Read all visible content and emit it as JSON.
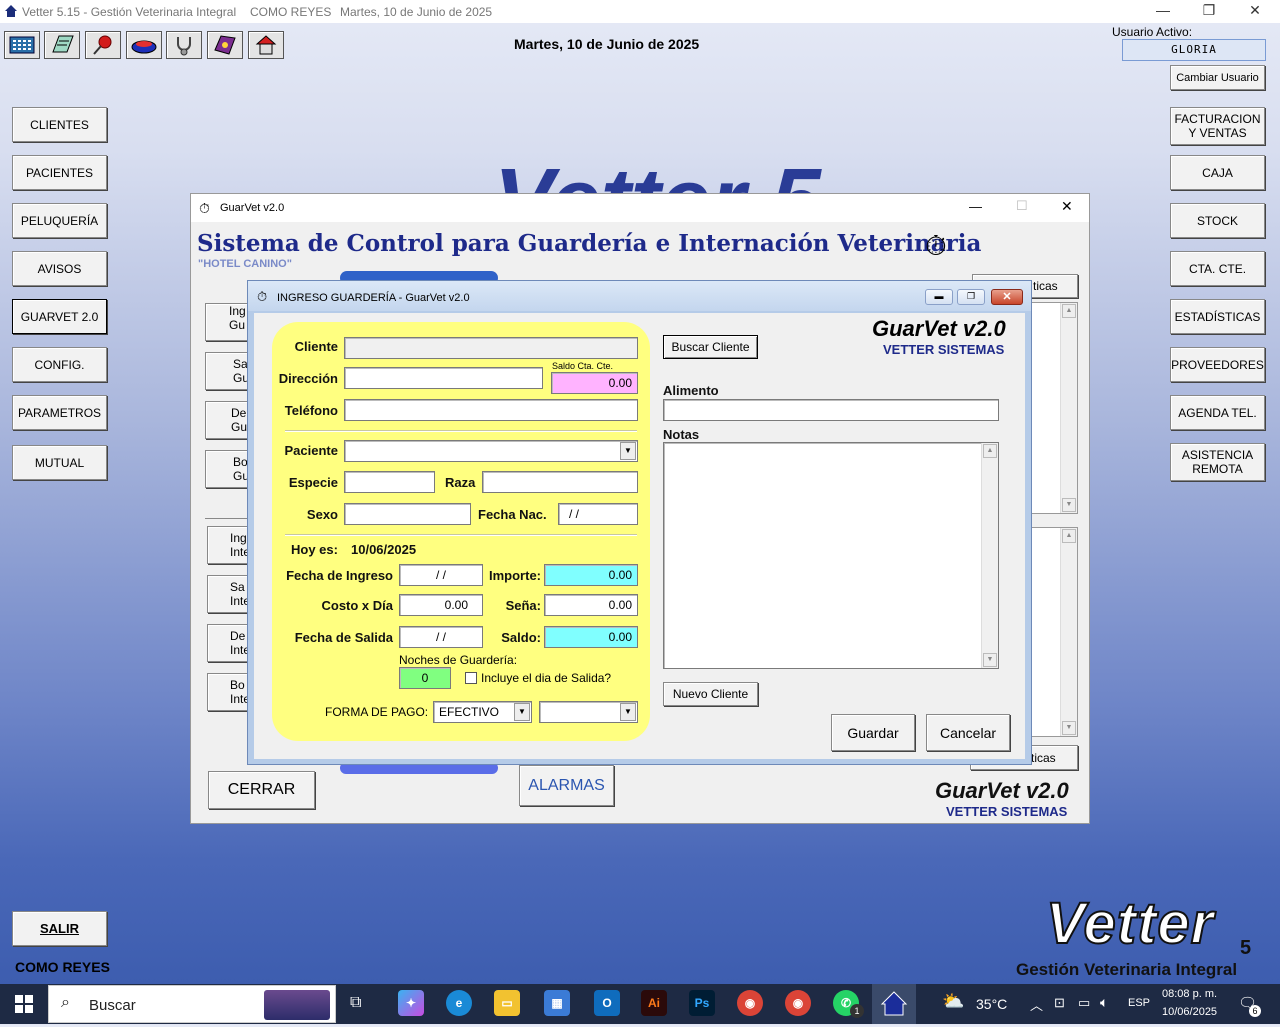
{
  "app": {
    "title": "Vetter 5.15 - Gestión Veterinaria Integral",
    "branch": "COMO REYES",
    "date_short": "Martes, 10 de Junio de 2025",
    "date_main": "Martes, 10 de Junio de 2025",
    "user_label": "Usuario Activo:",
    "user_name": "GLORIA",
    "change_user": "Cambiar Usuario",
    "watermark": "Vetter 5",
    "footer_branch": "COMO REYES",
    "logo_text": "Vetter",
    "logo_version": "5",
    "logo_sub": "Gestión Veterinaria Integral"
  },
  "toolbar_icons": [
    "calculator-icon",
    "notebook-icon",
    "pushpin-icon",
    "pet-bowl-icon",
    "stethoscope-icon",
    "book-icon",
    "house-icon"
  ],
  "left_menu": [
    {
      "label": "CLIENTES",
      "name": "clientes"
    },
    {
      "label": "PACIENTES",
      "name": "pacientes"
    },
    {
      "label": "PELUQUERÍA",
      "name": "peluqueria"
    },
    {
      "label": "AVISOS",
      "name": "avisos"
    },
    {
      "label": "GUARVET 2.0",
      "name": "guarvet"
    },
    {
      "label": "CONFIG.",
      "name": "config"
    },
    {
      "label": "PARAMETROS",
      "name": "parametros"
    },
    {
      "label": "MUTUAL",
      "name": "mutual"
    }
  ],
  "exit_label": "SALIR",
  "right_menu": [
    {
      "label": "FACTURACION Y VENTAS",
      "name": "facturacion"
    },
    {
      "label": "CAJA",
      "name": "caja"
    },
    {
      "label": "STOCK",
      "name": "stock"
    },
    {
      "label": "CTA. CTE.",
      "name": "cta-cte"
    },
    {
      "label": "ESTADÍSTICAS",
      "name": "estadisticas"
    },
    {
      "label": "PROVEEDORES",
      "name": "proveedores"
    },
    {
      "label": "AGENDA TEL.",
      "name": "agenda"
    },
    {
      "label": "ASISTENCIA REMOTA",
      "name": "asistencia"
    }
  ],
  "guarvet": {
    "window_title": "GuarVet v2.0",
    "heading": "Sistema de Control para Guardería e Internación Veterinaria",
    "subheading": "\"HOTEL CANINO\"",
    "side_buttons": [
      {
        "l1": "Ing",
        "l2": "Gu"
      },
      {
        "l1": "Sa",
        "l2": "Gu"
      },
      {
        "l1": "De",
        "l2": "Gu"
      },
      {
        "l1": "Bo",
        "l2": "Gu"
      },
      {
        "l1": "Ing",
        "l2": "Inte"
      },
      {
        "l1": "Sa",
        "l2": "Inte"
      },
      {
        "l1": "De",
        "l2": "Inte"
      },
      {
        "l1": "Bo",
        "l2": "Inte"
      }
    ],
    "right_top_button": "ticas",
    "right_bottom_button": "ticas",
    "close_label": "CERRAR",
    "alarms_label": "ALARMAS",
    "brand": "GuarVet v2.0",
    "brand_sub": "VETTER SISTEMAS"
  },
  "dialog": {
    "title": "INGRESO GUARDERÍA - GuarVet v2.0",
    "brand": "GuarVet v2.0",
    "brand_sub": "VETTER SISTEMAS",
    "labels": {
      "cliente": "Cliente",
      "direccion": "Dirección",
      "saldo_cta": "Saldo Cta. Cte.",
      "telefono": "Teléfono",
      "paciente": "Paciente",
      "especie": "Especie",
      "raza": "Raza",
      "sexo": "Sexo",
      "fecha_nac": "Fecha Nac.",
      "hoy_es": "Hoy es:",
      "fecha_ingreso": "Fecha de Ingreso",
      "importe": "Importe:",
      "costo_dia": "Costo x Día",
      "sena": "Seña:",
      "fecha_salida": "Fecha de Salida",
      "saldo": "Saldo:",
      "noches": "Noches de Guardería:",
      "incluye": "Incluye el dia de Salida?",
      "forma_pago": "FORMA DE PAGO:",
      "alimento": "Alimento",
      "notas": "Notas"
    },
    "values": {
      "cliente": "",
      "direccion": "",
      "saldo_cta": "0.00",
      "telefono": "",
      "paciente": "",
      "especie": "",
      "raza": "",
      "sexo": "",
      "fecha_nac": "/ /",
      "hoy_es": "10/06/2025",
      "fecha_ingreso": "/ /",
      "importe": "0.00",
      "costo_dia": "0.00",
      "sena": "0.00",
      "fecha_salida": "/ /",
      "saldo": "0.00",
      "noches": "0",
      "forma_pago": "EFECTIVO",
      "forma_pago_2": "",
      "alimento": "",
      "notas": ""
    },
    "buttons": {
      "buscar_cliente": "Buscar Cliente",
      "nuevo_cliente": "Nuevo Cliente",
      "guardar": "Guardar",
      "cancelar": "Cancelar"
    }
  },
  "taskbar": {
    "search_placeholder": "Buscar",
    "temperature": "35°C",
    "lang": "ESP",
    "time": "08:08 p. m.",
    "date": "10/06/2025",
    "notif_count": "6",
    "whatsapp_badge": "1"
  },
  "colors": {
    "yellow_panel": "#ffff80",
    "saldo_cta_bg": "#ffb3ff",
    "importe_bg": "#80ffff",
    "noches_bg": "#80ff80",
    "heading": "#1e2a8a"
  }
}
